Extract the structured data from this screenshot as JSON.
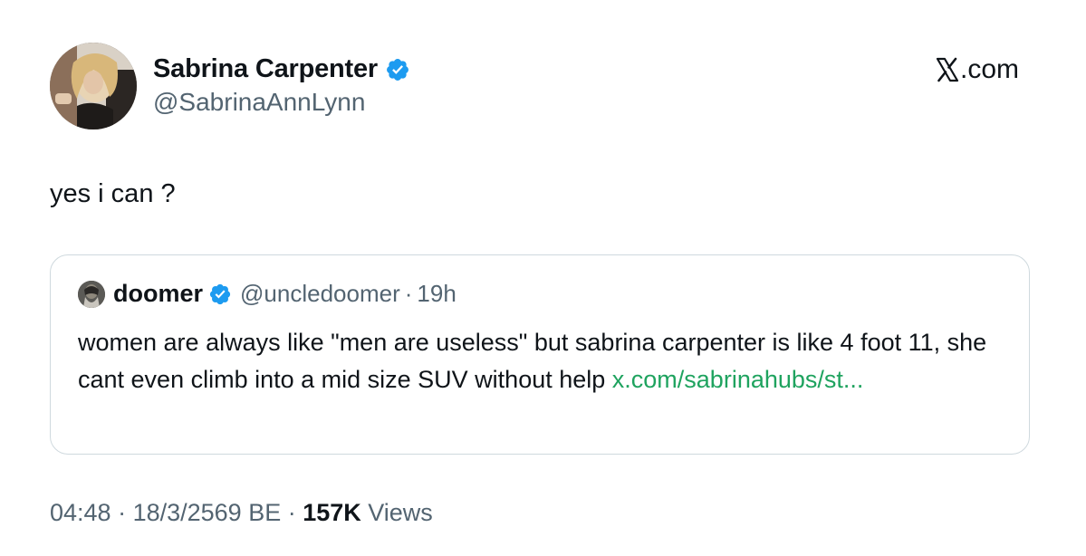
{
  "author": {
    "display_name": "Sabrina Carpenter",
    "handle": "@SabrinaAnnLynn"
  },
  "site": {
    "logo_mark": "𝕏",
    "label": ".com"
  },
  "tweet": {
    "text": "yes i can ?"
  },
  "quote": {
    "display_name": "doomer",
    "handle": "@uncledoomer",
    "separator": "·",
    "time": "19h",
    "text": "women are always like \"men are useless\" but sabrina carpenter is like 4 foot 11, she cant even climb into a mid size SUV without help ",
    "link": "x.com/sabrinahubs/st..."
  },
  "meta": {
    "time": "04:48",
    "dot1": " · ",
    "date": "18/3/2569 BE",
    "dot2": " · ",
    "views_count": "157K",
    "views_label": " Views"
  },
  "colors": {
    "verified": "#1d9bf0",
    "link": "#1fa35f",
    "secondary_text": "#536471",
    "border": "#cfd9de"
  },
  "icons": {
    "verified": "verified-badge-icon",
    "logo": "x-logo-icon"
  }
}
